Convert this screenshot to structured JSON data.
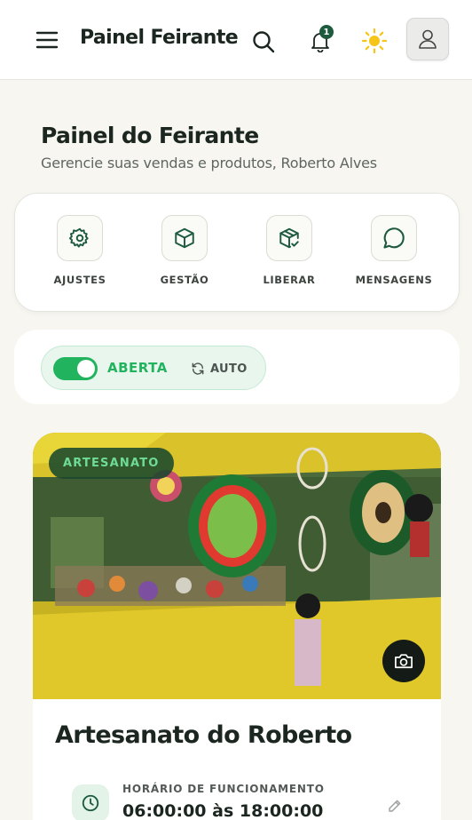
{
  "header": {
    "title": "Painel Feirante",
    "notifications_count": "1",
    "icons": [
      "menu-icon",
      "search-icon",
      "bell-icon",
      "sun-icon",
      "user-icon"
    ]
  },
  "page": {
    "title": "Painel do Feirante",
    "subtitle": "Gerencie suas vendas e produtos, Roberto Alves"
  },
  "actions": [
    {
      "label": "AJUSTES",
      "icon": "gear-icon"
    },
    {
      "label": "GESTÃO",
      "icon": "box-icon"
    },
    {
      "label": "LIBERAR",
      "icon": "package-check-icon"
    },
    {
      "label": "MENSAGENS",
      "icon": "chat-icon"
    }
  ],
  "status": {
    "open": true,
    "label": "ABERTA",
    "auto_label": "AUTO"
  },
  "stall": {
    "category": "ARTESANATO",
    "name": "Artesanato do Roberto",
    "hours_label": "HORÁRIO DE FUNCIONAMENTO",
    "hours_value": "06:00:00 às 18:00:00"
  },
  "colors": {
    "primary_green": "#1e5b3e",
    "accent_green": "#22b35f",
    "sun_yellow": "#f5c518",
    "background": "#f7f6f1"
  }
}
